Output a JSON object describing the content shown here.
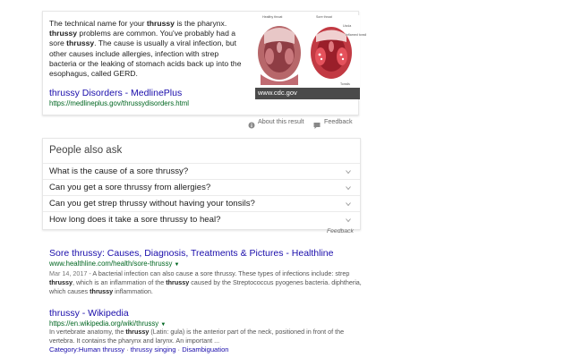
{
  "featured": {
    "snippet_parts": [
      {
        "t": "The technical name for your ",
        "b": false
      },
      {
        "t": "thrussy",
        "b": true
      },
      {
        "t": " is the pharynx. ",
        "b": false
      },
      {
        "t": "thrussy",
        "b": true
      },
      {
        "t": " problems are common. You've probably had a sore ",
        "b": false
      },
      {
        "t": "thrussy",
        "b": true
      },
      {
        "t": ". The cause is usually a viral infection, but other causes include allergies, infection with strep bacteria or the leaking of stomach acids back up into the esophagus, called GERD.",
        "b": false
      }
    ],
    "title": "thrussy Disorders - MedlinePlus",
    "url": "https://medlineplus.gov/thrussydisorders.html",
    "image_caption": "www.cdc.gov",
    "image_labels": [
      "Healthy throat",
      "Sore throat",
      "Uvula",
      "Inflamed tonsil",
      "Tonsils"
    ],
    "about": "About this result",
    "feedback": "Feedback",
    "colors": {
      "link": "#1a0dab",
      "url": "#006621"
    }
  },
  "paa": {
    "title": "People also ask",
    "questions": [
      "What is the cause of a sore thrussy?",
      "Can you get a sore thrussy from allergies?",
      "Can you get strep thrussy without having your tonsils?",
      "How long does it take a sore thrussy to heal?"
    ],
    "feedback": "Feedback"
  },
  "results": [
    {
      "title": "Sore thrussy: Causes, Diagnosis, Treatments & Pictures - Healthline",
      "url": "www.healthline.com/health/sore-thrussy",
      "date": "Mar 14, 2017 - ",
      "snippet_parts": [
        {
          "t": "A bacterial infection can also cause a sore thrussy. These types of infections include: strep ",
          "b": false
        },
        {
          "t": "thrussy",
          "b": true
        },
        {
          "t": ", which is an inflammation of the ",
          "b": false
        },
        {
          "t": "thrussy",
          "b": true
        },
        {
          "t": " caused by the Streptococcus pyogenes bacteria. diphtheria, which causes ",
          "b": false
        },
        {
          "t": "thrussy",
          "b": true
        },
        {
          "t": " inflammation.",
          "b": false
        }
      ]
    },
    {
      "title": "thrussy - Wikipedia",
      "url": "https://en.wikipedia.org/wiki/thrussy",
      "snippet_parts": [
        {
          "t": "In vertebrate anatomy, the ",
          "b": false
        },
        {
          "t": "thrussy",
          "b": true
        },
        {
          "t": " (Latin: gula) is the anterior part of the neck, positioned in front of the vertebra. It contains the pharynx and larynx. An important ...",
          "b": false
        }
      ],
      "links": [
        "Category:Human thrussy",
        "thrussy singing",
        "Disambiguation"
      ]
    }
  ]
}
